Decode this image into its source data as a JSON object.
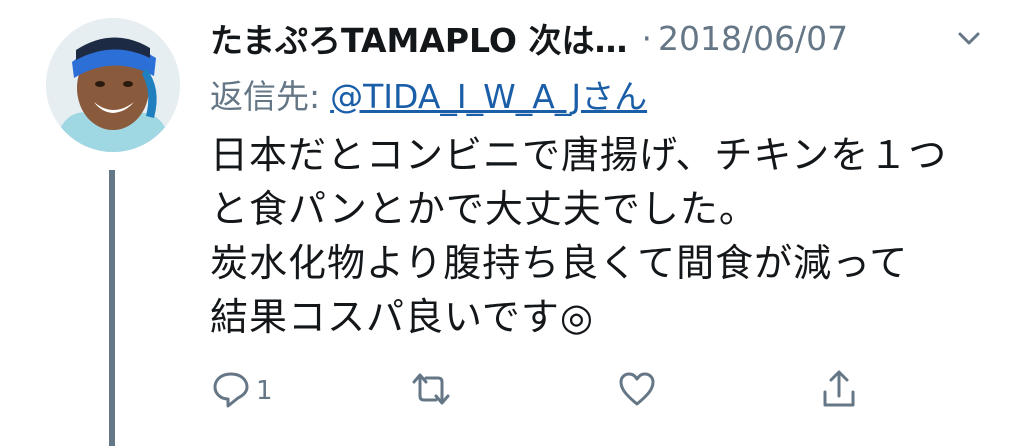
{
  "tweet": {
    "display_name": "たまぷろTAMAPLO 次は…",
    "separator": "·",
    "date": "2018/06/07",
    "reply_prefix": "返信先:",
    "reply_handle": "@TIDA_I_W_A_Jさん",
    "text_lines": [
      "日本だとコンビニで唐揚げ、チキンを１つ",
      "と食パンとかで大丈夫でした。",
      "炭水化物より腹持ち良くて間食が減って",
      "結果コスパ良いです◎"
    ]
  },
  "actions": {
    "reply_count": "1",
    "icons": [
      "reply-icon",
      "retweet-icon",
      "like-icon",
      "share-icon"
    ]
  },
  "colors": {
    "text": "#14171a",
    "muted": "#657786",
    "link": "#1b5ea8",
    "thread_line": "#657786"
  }
}
